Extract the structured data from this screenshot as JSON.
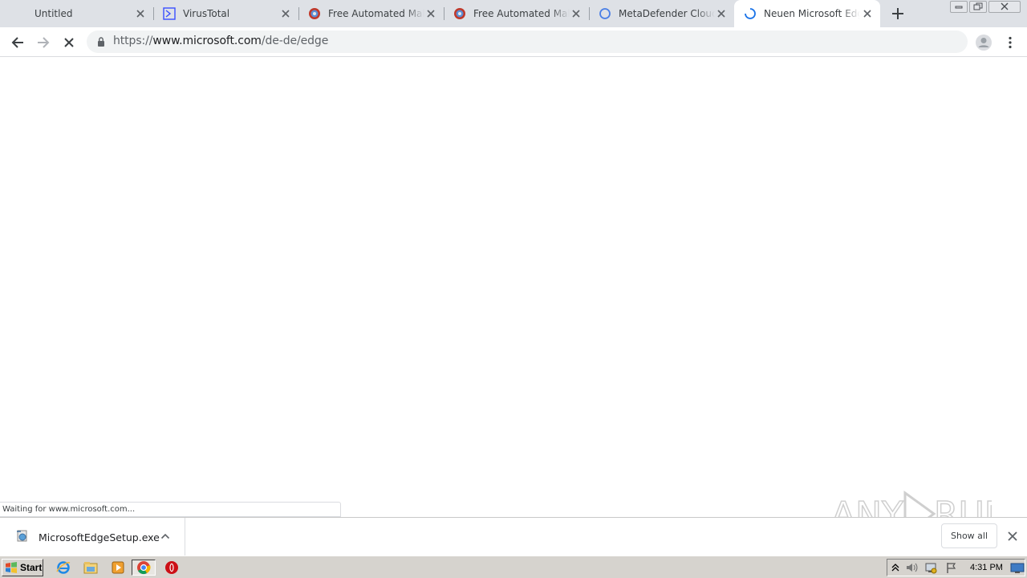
{
  "browser": {
    "tabs": [
      {
        "title": "Untitled",
        "icon": "blank-icon"
      },
      {
        "title": "VirusTotal",
        "icon": "virustotal-icon"
      },
      {
        "title": "Free Automated Malware",
        "icon": "hybrid-analysis-icon"
      },
      {
        "title": "Free Automated Malware",
        "icon": "hybrid-analysis-icon"
      },
      {
        "title": "MetaDefender Cloud | R",
        "icon": "loading-spinner-icon"
      },
      {
        "title": "Neuen Microsoft Edge-B",
        "icon": "loading-spinner-icon"
      }
    ],
    "active_tab_index": 5,
    "address": {
      "scheme": "https://",
      "host": "www.microsoft.com",
      "path": "/de-de/edge"
    },
    "status_text": "Waiting for www.microsoft.com..."
  },
  "downloads": {
    "file_name": "MicrosoftEdgeSetup.exe",
    "show_all_label": "Show all"
  },
  "watermark": {
    "text": "ANY RUN"
  },
  "taskbar": {
    "start_label": "Start",
    "clock": "4:31 PM",
    "pinned": [
      "internet-explorer-icon",
      "file-explorer-icon",
      "media-player-icon",
      "chrome-icon",
      "opera-icon"
    ]
  },
  "colors": {
    "tabstrip": "#dee1e6",
    "taskbar": "#d6d3ce",
    "accent_blue": "#1a73e8"
  }
}
